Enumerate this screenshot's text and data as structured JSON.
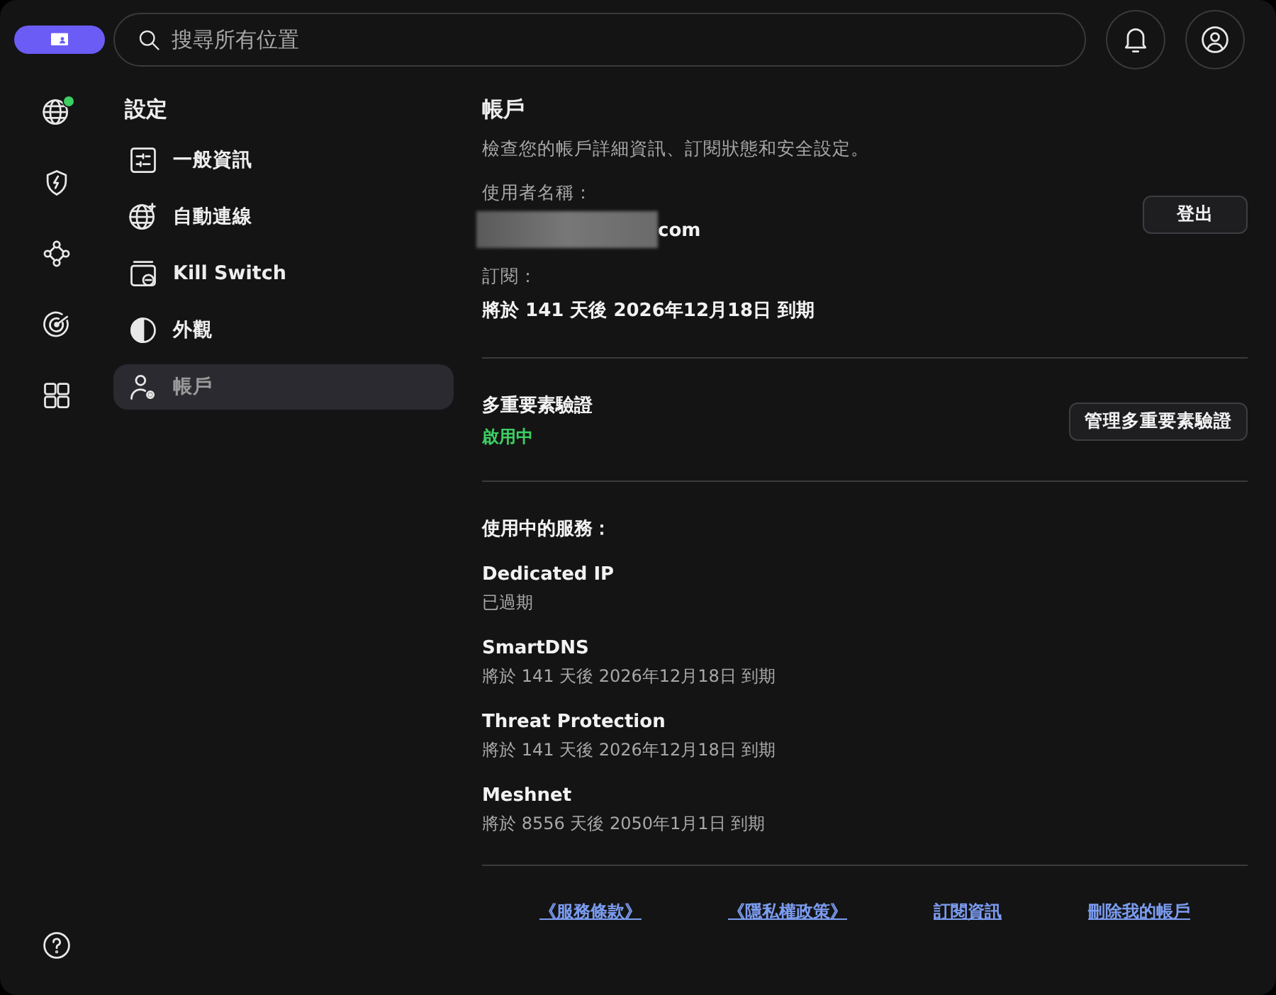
{
  "search": {
    "placeholder": "搜尋所有位置"
  },
  "rail": [
    {
      "kind": "globe",
      "selected": false,
      "color": "#3ccf63"
    },
    {
      "kind": "shield",
      "selected": false
    },
    {
      "kind": "mesh",
      "selected": false
    },
    {
      "kind": "radar",
      "selected": false
    },
    {
      "kind": "apps",
      "selected": false
    }
  ],
  "settings": {
    "title": "設定",
    "items": [
      {
        "kind": "sliders",
        "label": "一般資訊",
        "selected": false
      },
      {
        "kind": "globe",
        "label": "自動連線",
        "selected": false
      },
      {
        "kind": "killswitch",
        "label": "Kill Switch",
        "selected": false
      },
      {
        "kind": "contrast",
        "label": "外觀",
        "selected": false
      },
      {
        "kind": "account",
        "label": "帳戶",
        "selected": true
      }
    ]
  },
  "account": {
    "title": "帳戶",
    "description": "檢查您的帳戶詳細資訊、訂閱狀態和安全設定。",
    "username_label": "使用者名稱：",
    "username": "com",
    "username_redacted": true,
    "logout_button": "登出",
    "subscription_label": "訂閱：",
    "subscription": "將於 141 天後 2026年12月18日 到期",
    "mfa": {
      "title": "多重要素驗證",
      "status": "啟用中",
      "on": true,
      "button": "管理多重要素驗證"
    },
    "services_title": "使用中的服務：",
    "services": [
      {
        "name": "Dedicated IP",
        "status": "已過期"
      },
      {
        "name": "SmartDNS",
        "status": "將於 141 天後 2026年12月18日 到期"
      },
      {
        "name": "Threat Protection",
        "status": "將於 141 天後 2026年12月18日 到期"
      },
      {
        "name": "Meshnet",
        "status": "將於 8556 天後 2050年1月1日 到期"
      }
    ],
    "links": [
      "《服務條款》",
      "《隱私權政策》",
      "訂閱資訊",
      "刪除我的帳戶"
    ]
  }
}
